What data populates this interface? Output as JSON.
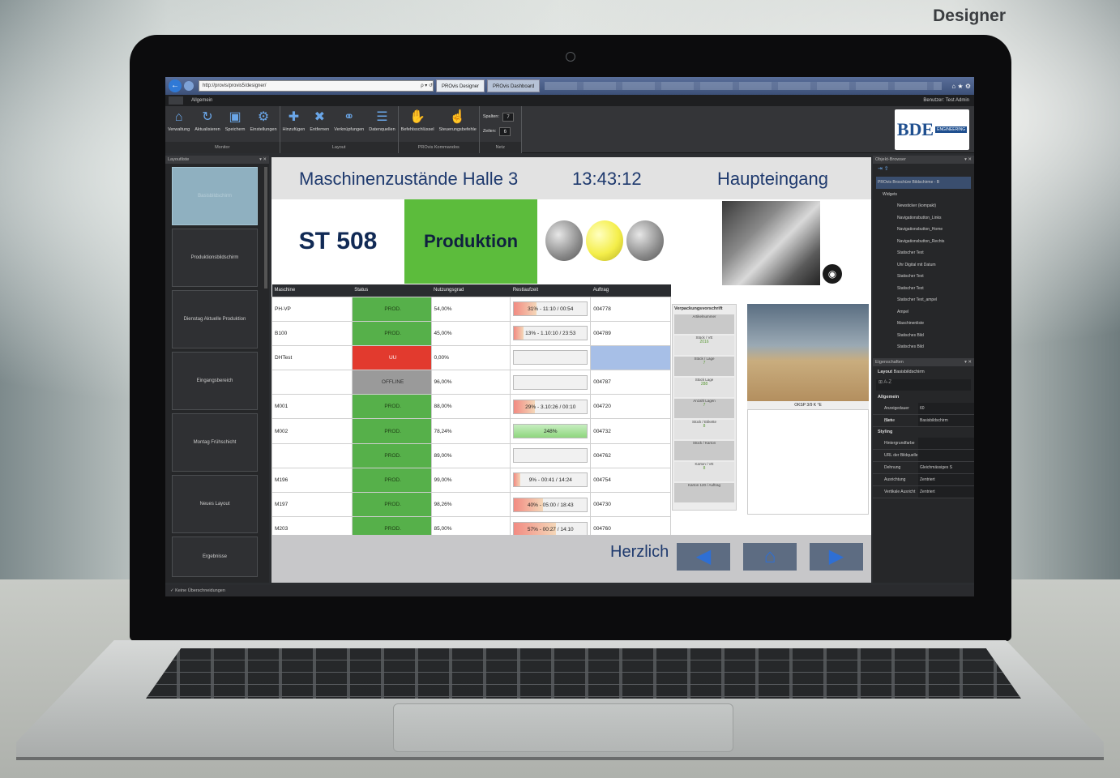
{
  "brand": "Designer",
  "browser": {
    "url": "http://provis/provis5/designer/",
    "search_glyph": "ρ ▾ ↺",
    "tabs": [
      "PROvis Designer",
      "PROvis Dashboard"
    ],
    "icons": "⌂ ★ ⚙"
  },
  "menubar": {
    "tab": "Allgemein",
    "user": "Benutzer: Test Admin"
  },
  "ribbon": {
    "groups": [
      {
        "name": "Monitor",
        "items": [
          "Verwaltung",
          "Aktualisieren",
          "Speichern",
          "Einstellungen"
        ]
      },
      {
        "name": "Layout",
        "items": [
          "Hinzufügen",
          "Entfernen",
          "Verknüpfungen",
          "Datenquellen"
        ]
      },
      {
        "name": "PROvis Kommandos",
        "items": [
          "Befehlsschlüssel",
          "Steuerungsbefehle"
        ]
      },
      {
        "name": "Netz",
        "spalten_label": "Spalten:",
        "spalten": "7",
        "zeilen_label": "Zeilen:",
        "zeilen": "6"
      }
    ]
  },
  "logo": {
    "text": "BDE",
    "sub": "ENGINEERING"
  },
  "left_panel": {
    "title": "Layoutliste",
    "items": [
      "Basisbildschirm",
      "Produktionsbildschirm",
      "Dienstag Aktuelle Produktion",
      "Eingangsbereich",
      "Montag Frühschicht",
      "Neues Layout",
      "Ergebnisse"
    ]
  },
  "canvas": {
    "title": "Maschinenzustände Halle 3",
    "time": "13:43:12",
    "location": "Haupteingang",
    "station": "ST 508",
    "state": "Produktion",
    "table": {
      "headers": [
        "Maschine",
        "Status",
        "Nutzungsgrad",
        "Restlaufzeit",
        "Auftrag"
      ],
      "rows": [
        {
          "m": "PH-VP",
          "s": "PROD.",
          "n": "54,00%",
          "r": "31% - 11:10 / 00:54",
          "a": "004778"
        },
        {
          "m": "B100",
          "s": "PROD.",
          "n": "45,00%",
          "r": "13% - 1.10:10 / 23:53",
          "a": "004789"
        },
        {
          "m": "DHTest",
          "s": "UU",
          "n": "0,00%",
          "r": "",
          "a": ""
        },
        {
          "m": "",
          "s": "OFFLINE",
          "n": "96,00%",
          "r": "",
          "a": "004787"
        },
        {
          "m": "M001",
          "s": "PROD.",
          "n": "88,00%",
          "r": "29% - 3.10:26 / 00:10",
          "a": "004720"
        },
        {
          "m": "M002",
          "s": "PROD.",
          "n": "78,24%",
          "r": "248%",
          "a": "004732"
        },
        {
          "m": "",
          "s": "PROD.",
          "n": "89,00%",
          "r": "",
          "a": "004762"
        },
        {
          "m": "M196",
          "s": "PROD.",
          "n": "99,00%",
          "r": "9% - 00:41 / 14:24",
          "a": "004754"
        },
        {
          "m": "M197",
          "s": "PROD.",
          "n": "98,26%",
          "r": "40% - 05:00 / 18:43",
          "a": "004730"
        },
        {
          "m": "M203",
          "s": "PROD.",
          "n": "85,00%",
          "r": "57% - 00:27 / 14:10",
          "a": "004760"
        }
      ],
      "progress": [
        0.31,
        0.13,
        0,
        0,
        0.29,
        1.0,
        0,
        0.09,
        0.4,
        0.57
      ]
    },
    "packaging": {
      "title": "Verpackungsvorschrift",
      "rows": [
        {
          "label": "Artikelnummer",
          "value": ""
        },
        {
          "label": "Stück / VE",
          "value": "2016"
        },
        {
          "label": "Stück / Lage",
          "value": "7"
        },
        {
          "label": "Stück Lage",
          "value": "288"
        },
        {
          "label": "Anzahl Lagen",
          "value": "7"
        },
        {
          "label": "Stück / Etikette",
          "value": "8"
        },
        {
          "label": "Stück / Karton",
          "value": ""
        },
        {
          "label": "Karton / VE",
          "value": "8"
        },
        {
          "label": "Karton 120 / Auftrag",
          "value": ""
        }
      ]
    },
    "pallet_label": "OKSP 3/9 K        °E",
    "footer": {
      "ticker": "Herzlich",
      "back": "◀",
      "home": "⌂",
      "next": "▶"
    }
  },
  "right_panel": {
    "title": "Objekt-Browser",
    "tree": [
      "PROvis Broschüre Bildschirme - B",
      "Widgets",
      "Newsticker (kompakt)",
      "Navigationsbutton_Links",
      "Navigationsbutton_Home",
      "Navigationsbutton_Rechts",
      "Statischer Text",
      "Uhr Digital mit Datum",
      "Statischer Text",
      "Statischer Text",
      "Statischer Text_ampel",
      "Ampel",
      "Maschinenliste",
      "Statisches Bild",
      "Statisches Bild"
    ],
    "props_title": "Eigenschaften",
    "props_subtitle": "Layout",
    "props_subject": "Basisbildschirm",
    "section1": "Allgemein",
    "props1": [
      {
        "k": "Anzeigedauer (Sek",
        "v": "60"
      },
      {
        "k": "Name",
        "v": "Basisbildschirm"
      }
    ],
    "section2": "Styling",
    "props2": [
      {
        "k": "Hintergrundfarbe",
        "v": ""
      },
      {
        "k": "URL der Bildquelle",
        "v": ""
      },
      {
        "k": "Dehnung",
        "v": "Gleichmässiges S"
      },
      {
        "k": "Ausrichtung",
        "v": "Zentriert"
      },
      {
        "k": "Vertikale Ausricht",
        "v": "Zentriert"
      }
    ]
  },
  "status": "✓ Keine Überschneidungen"
}
